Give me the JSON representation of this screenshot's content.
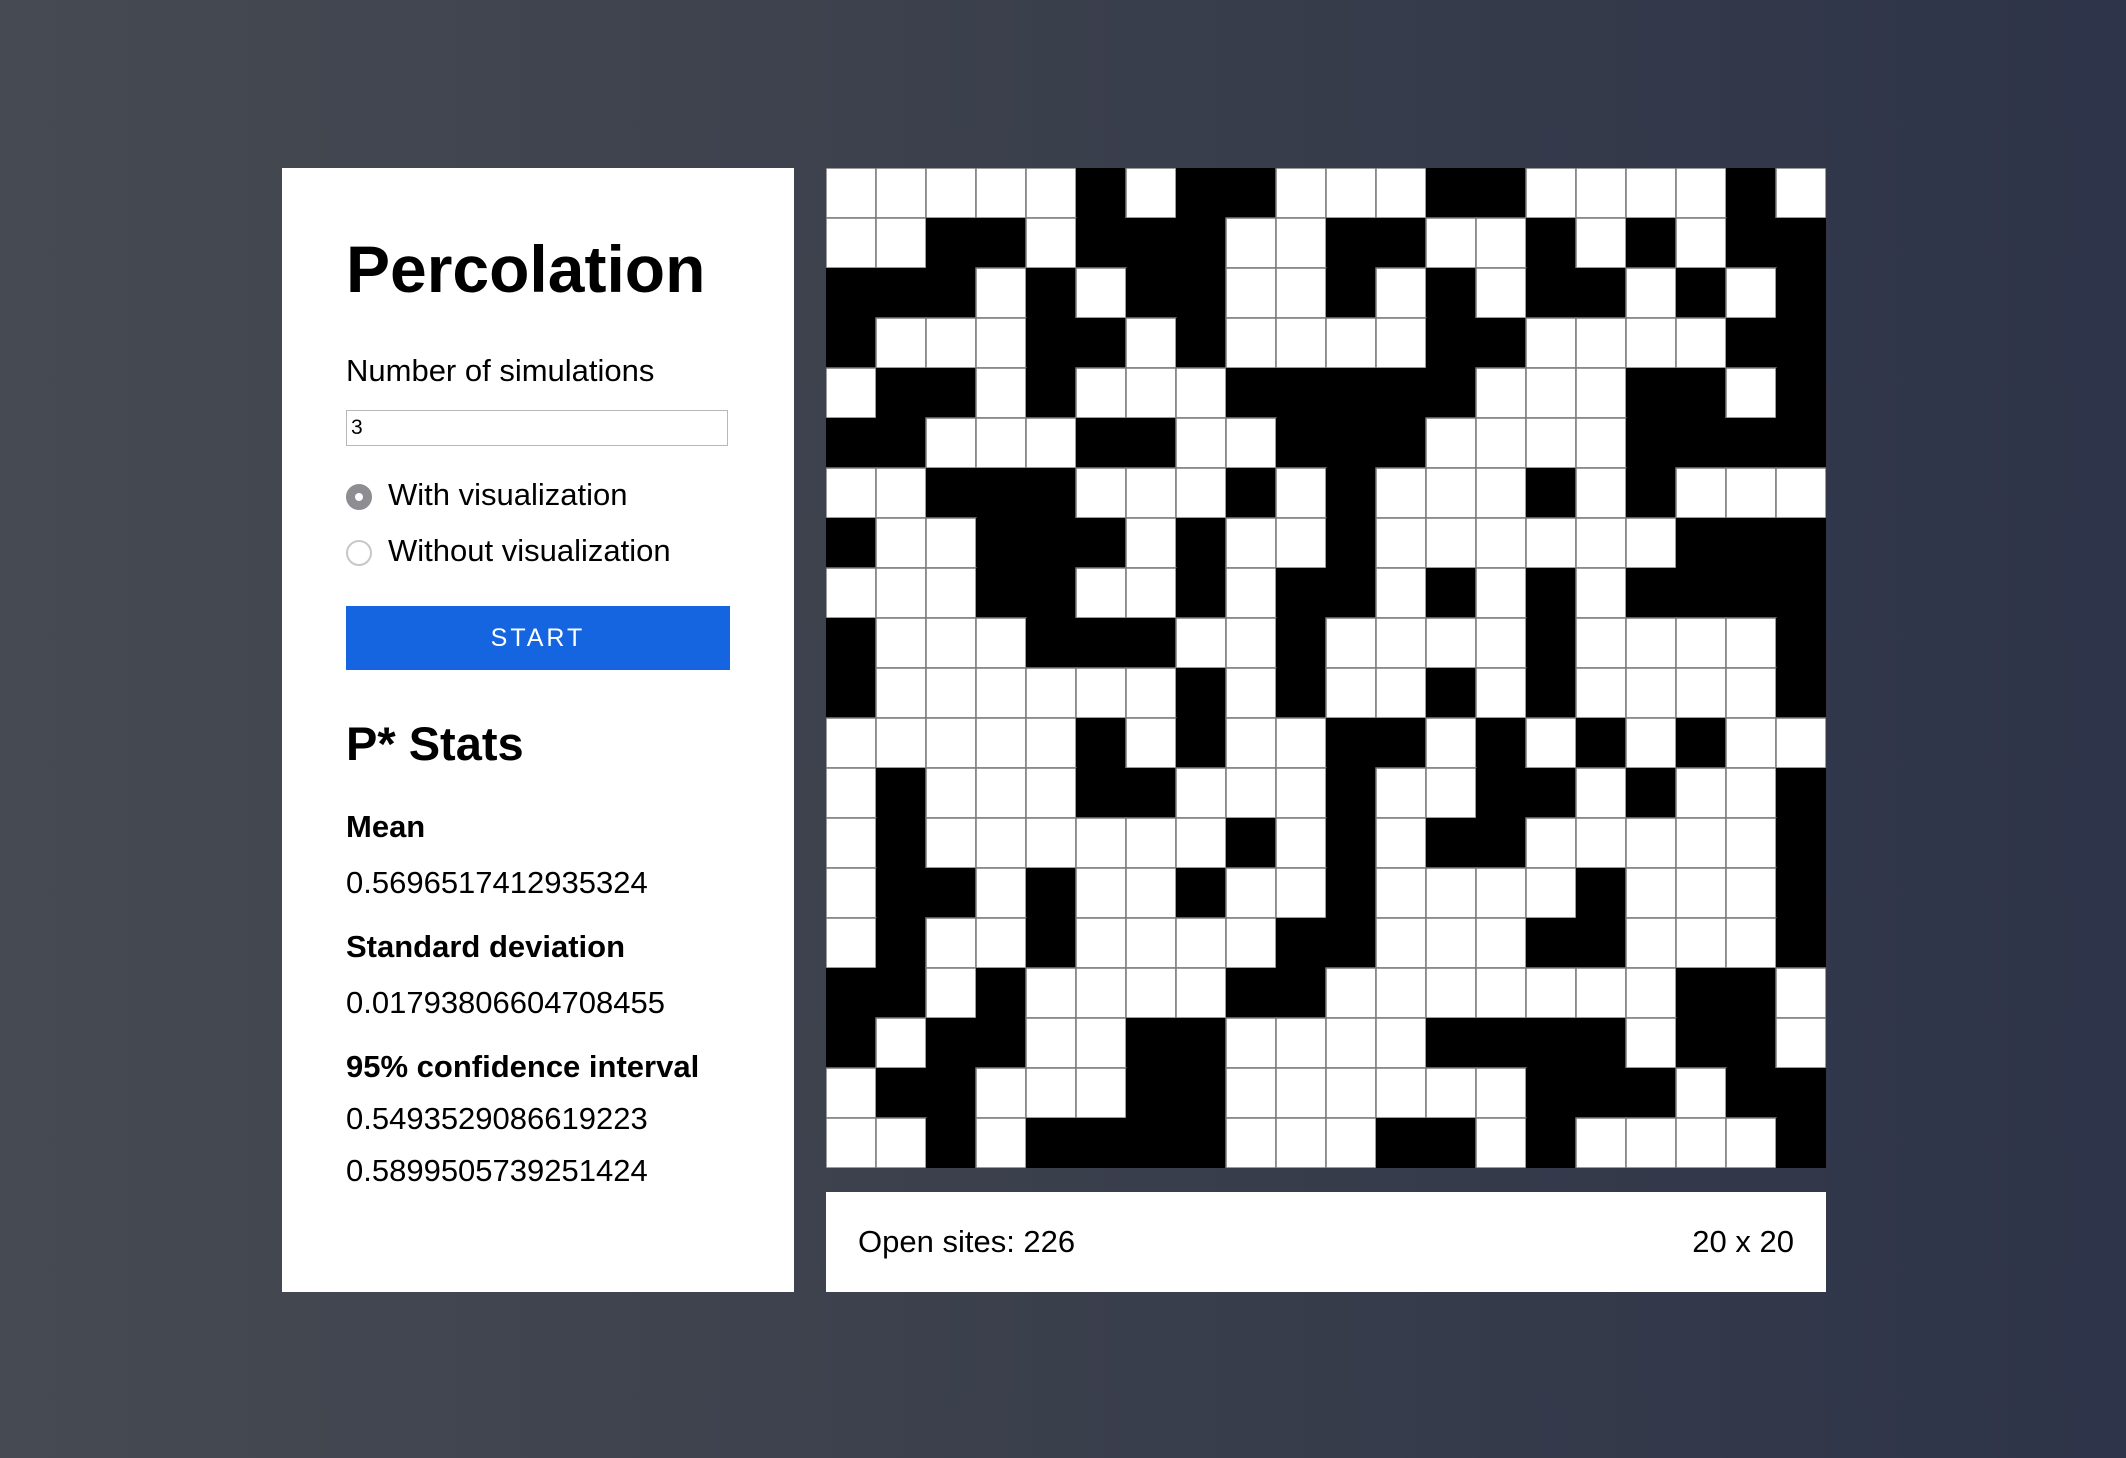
{
  "sidebar": {
    "title": "Percolation",
    "simulations_label": "Number of simulations",
    "simulations_value": "3",
    "radio_with": "With visualization",
    "radio_without": "Without visualization",
    "selected_mode": "with",
    "start_label": "START",
    "stats_title": "P* Stats",
    "mean_label": "Mean",
    "mean_value": "0.5696517412935324",
    "stddev_label": "Standard deviation",
    "stddev_value": "0.01793806604708455",
    "ci_label": "95% confidence interval",
    "ci_low": "0.5493529086619223",
    "ci_high": "0.5899505739251424"
  },
  "grid": {
    "rows": 20,
    "cols": 20,
    "open_color": "#ffffff",
    "blocked_color": "#000000",
    "line_color": "#7a7a7a",
    "cells": [
      "11111010011100111101",
      "11001000110011010100",
      "00010100110101001010",
      "01110010111100111100",
      "10010111000001110010",
      "00111001100011110000",
      "11000111010111010111",
      "01100010110111111000",
      "11100110100101010000",
      "01110001101111011110",
      "01111110101101011110",
      "11111010110010101011",
      "10111001110110010110",
      "10111111010100111110",
      "10010110110111101110",
      "10110111100111001110",
      "00101111001111111001",
      "01001100111100001001",
      "10011100111111000100",
      "11010000111001011110"
    ]
  },
  "footer": {
    "open_sites": "Open sites: 226",
    "size": "20 x 20"
  }
}
